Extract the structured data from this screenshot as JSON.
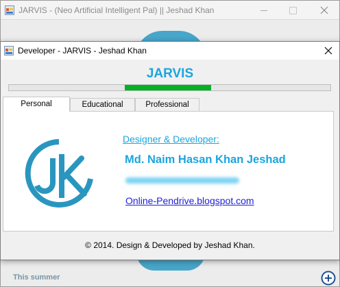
{
  "main_window": {
    "title": "JARVIS - (Neo Artificial Intelligent Pal) || Jeshad Khan",
    "status_text": "This summer",
    "icons": {
      "app": "app-window-icon",
      "minimize": "minimize-icon",
      "maximize": "maximize-icon",
      "close": "close-icon",
      "add": "add-circle-icon"
    }
  },
  "dialog": {
    "title": "Developer - JARVIS - Jeshad Khan",
    "heading": "JARVIS",
    "progress": {
      "value_start": 0.36,
      "value_end": 0.63
    },
    "tabs": [
      {
        "label": "Personal",
        "selected": true
      },
      {
        "label": "Educational",
        "selected": false
      },
      {
        "label": "Professional",
        "selected": false
      }
    ],
    "personal": {
      "role": "Designer & Developer:",
      "name": "Md. Naim Hasan Khan Jeshad",
      "website": "Online-Pendrive.blogspot.com",
      "logo": "jk-logo"
    },
    "footer": "© 2014. Design & Developed by Jeshad Khan."
  },
  "colors": {
    "accent": "#1aa5df",
    "progress": "#06b025",
    "link": "#1d1dd8",
    "logo": "#2a96bf"
  }
}
